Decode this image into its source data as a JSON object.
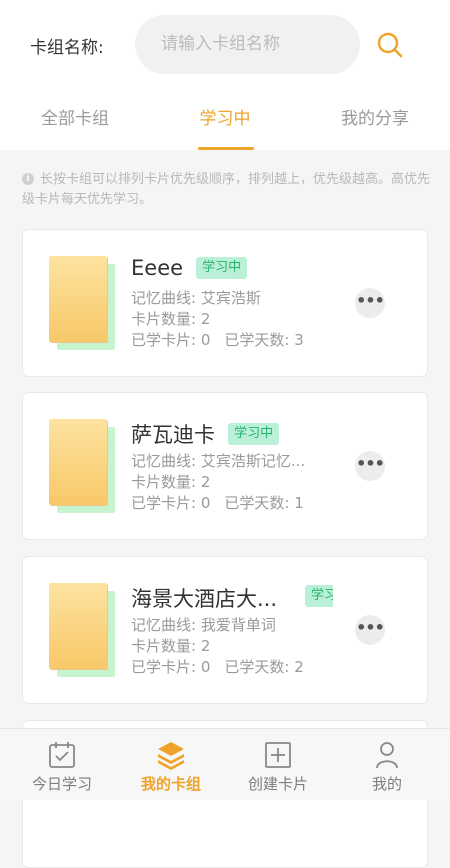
{
  "search": {
    "label": "卡组名称:",
    "placeholder": "请输入卡组名称"
  },
  "tabs": [
    {
      "label": "全部卡组",
      "active": false
    },
    {
      "label": "学习中",
      "active": true
    },
    {
      "label": "我的分享",
      "active": false
    }
  ],
  "tip": {
    "icon": "info-icon",
    "text": "长按卡组可以排列卡片优先级顺序，排列越上，优先级越高。高优先级卡片每天优先学习。"
  },
  "cards": [
    {
      "title": "Eeee",
      "badge": "学习中",
      "curve": "记忆曲线: 艾宾浩斯",
      "count": "卡片数量: 2",
      "learned": "已学卡片: 0",
      "days": "已学天数: 3"
    },
    {
      "title": "萨瓦迪卡",
      "badge": "学习中",
      "curve": "记忆曲线: 艾宾浩斯记忆...",
      "count": "卡片数量: 2",
      "learned": "已学卡片: 0",
      "days": "已学天数: 1"
    },
    {
      "title": "海景大酒店大...",
      "badge": "学习中",
      "curve": "记忆曲线: 我爱背单词",
      "count": "卡片数量: 2",
      "learned": "已学卡片: 0",
      "days": "已学天数: 2"
    }
  ],
  "nav": [
    {
      "label": "今日学习",
      "icon": "calendar-check-icon",
      "active": false
    },
    {
      "label": "我的卡组",
      "icon": "layers-icon",
      "active": true
    },
    {
      "label": "创建卡片",
      "icon": "add-card-icon",
      "active": false
    },
    {
      "label": "我的",
      "icon": "person-icon",
      "active": false
    }
  ],
  "colors": {
    "accent": "#f0a32a",
    "badge_bg": "#b9f0d7",
    "badge_text": "#26b36e"
  }
}
